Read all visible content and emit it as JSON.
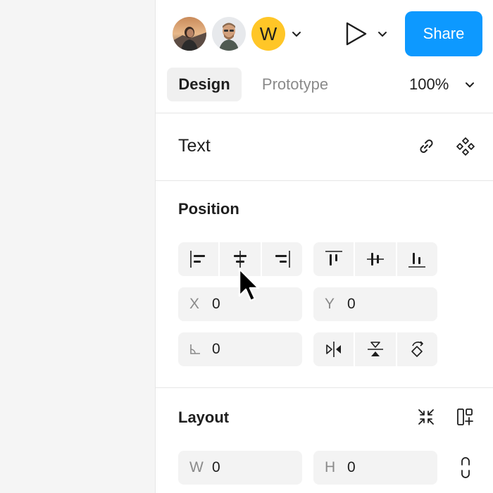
{
  "header": {
    "avatar_initial": "W",
    "share_label": "Share"
  },
  "tabs": [
    {
      "label": "Design",
      "active": true
    },
    {
      "label": "Prototype",
      "active": false
    }
  ],
  "zoom": "100%",
  "sections": {
    "text": {
      "title": "Text"
    },
    "position": {
      "title": "Position",
      "x_label": "X",
      "x_value": "0",
      "y_label": "Y",
      "y_value": "0",
      "rotation_value": "0"
    },
    "layout": {
      "title": "Layout",
      "w_label": "W",
      "w_value": "0",
      "h_label": "H",
      "h_value": "0"
    }
  },
  "icons": {
    "text_section": [
      "link-icon",
      "component-icon"
    ],
    "align_horizontal": [
      "align-left-icon",
      "align-center-horizontal-icon",
      "align-right-icon"
    ],
    "align_vertical": [
      "align-top-icon",
      "align-center-vertical-icon",
      "align-bottom-icon"
    ],
    "transform": [
      "flip-horizontal-icon",
      "flip-vertical-icon",
      "rotate-icon"
    ],
    "layout": [
      "collapse-icon",
      "auto-layout-icon",
      "constrain-proportions-icon"
    ]
  },
  "colors": {
    "accent": "#0d99ff",
    "avatar_yellow": "#ffc627",
    "field_bg": "#f3f3f3",
    "muted_text": "#8a8a8a"
  }
}
